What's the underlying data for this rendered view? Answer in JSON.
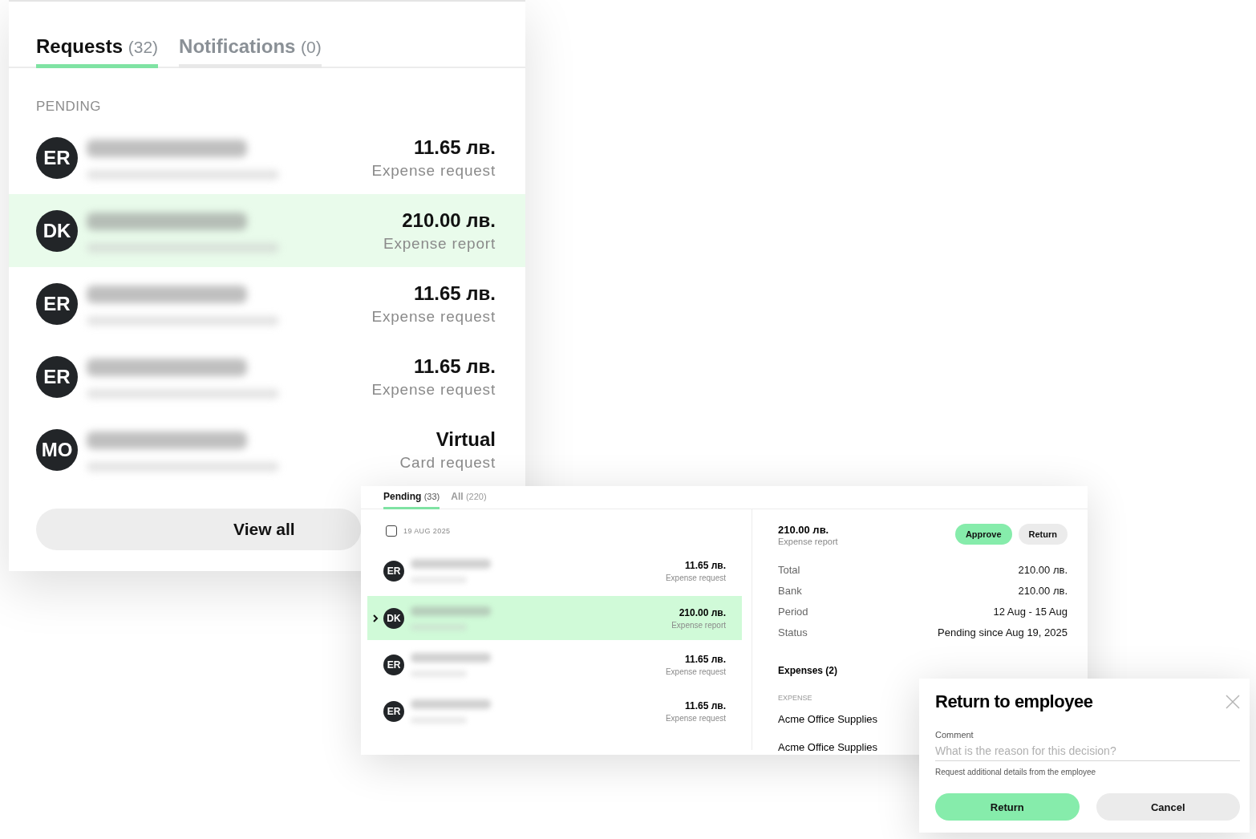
{
  "requests_panel": {
    "tabs": [
      {
        "label": "Requests",
        "count": "(32)",
        "selected": true
      },
      {
        "label": "Notifications",
        "count": "(0)",
        "selected": false
      }
    ],
    "section": "PENDING",
    "rows": [
      {
        "initials": "ER",
        "amount": "11.65 лв.",
        "type": "Expense request",
        "selected": false
      },
      {
        "initials": "DK",
        "amount": "210.00 лв.",
        "type": "Expense report",
        "selected": true
      },
      {
        "initials": "ER",
        "amount": "11.65 лв.",
        "type": "Expense request",
        "selected": false
      },
      {
        "initials": "ER",
        "amount": "11.65 лв.",
        "type": "Expense request",
        "selected": false
      },
      {
        "initials": "MO",
        "amount": "Virtual",
        "type": "Card request",
        "selected": false
      }
    ],
    "view_all": "View all"
  },
  "approvals_panel": {
    "tabs": [
      {
        "label": "Pending",
        "count": "(33)",
        "selected": true
      },
      {
        "label": "All",
        "count": "(220)",
        "selected": false
      }
    ],
    "date_group": {
      "label": "19 AUG 2025",
      "checked": false
    },
    "rows": [
      {
        "initials": "ER",
        "amount": "11.65 лв.",
        "type": "Expense request",
        "selected": false
      },
      {
        "initials": "DK",
        "amount": "210.00 лв.",
        "type": "Expense report",
        "selected": true
      },
      {
        "initials": "ER",
        "amount": "11.65 лв.",
        "type": "Expense request",
        "selected": false
      },
      {
        "initials": "ER",
        "amount": "11.65 лв.",
        "type": "Expense request",
        "selected": false
      }
    ],
    "detail": {
      "amount": "210.00 лв.",
      "type": "Expense report",
      "buttons": [
        {
          "label": "Approve",
          "kind": "primary"
        },
        {
          "label": "Return",
          "kind": "secondary"
        }
      ],
      "fields": [
        {
          "label": "Total",
          "value": "210.00 лв."
        },
        {
          "label": "Bank",
          "value": "210.00 лв."
        },
        {
          "label": "Period",
          "value": "12 Aug - 15 Aug"
        },
        {
          "label": "Status",
          "value": "Pending since Aug 19, 2025"
        }
      ],
      "expenses_title": "Expenses (2)",
      "expense_header": "EXPENSE",
      "expenses": [
        "Acme Office Supplies",
        "Acme Office Supplies"
      ]
    }
  },
  "return_dialog": {
    "title": "Return to employee",
    "comment_label": "Comment",
    "placeholder": "What is the reason for this decision?",
    "hint": "Request additional details from the employee",
    "buttons": [
      {
        "label": "Return",
        "kind": "primary"
      },
      {
        "label": "Cancel",
        "kind": "secondary"
      }
    ]
  }
}
